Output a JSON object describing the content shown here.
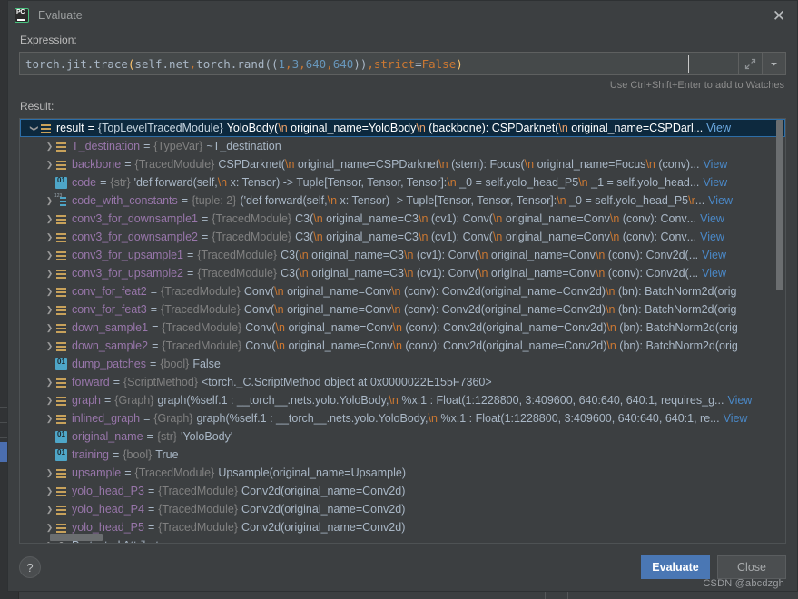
{
  "window": {
    "title": "Evaluate",
    "app_icon": "pycharm-icon",
    "close_icon": "close-icon"
  },
  "expression": {
    "label": "Expression:",
    "tokens": [
      {
        "t": "torch.jit.trace",
        "c": "plain"
      },
      {
        "t": "(",
        "c": "brace-y"
      },
      {
        "t": "self.net",
        "c": "plain"
      },
      {
        "t": ",",
        "c": "punct"
      },
      {
        "t": " torch.rand",
        "c": "plain"
      },
      {
        "t": "((",
        "c": "plain"
      },
      {
        "t": "1",
        "c": "num"
      },
      {
        "t": ",",
        "c": "punct"
      },
      {
        "t": " ",
        "c": "plain"
      },
      {
        "t": "3",
        "c": "num"
      },
      {
        "t": ",",
        "c": "punct"
      },
      {
        "t": " ",
        "c": "plain"
      },
      {
        "t": "640",
        "c": "num"
      },
      {
        "t": ",",
        "c": "punct"
      },
      {
        "t": " ",
        "c": "plain"
      },
      {
        "t": "640",
        "c": "num"
      },
      {
        "t": "))",
        "c": "plain"
      },
      {
        "t": ",",
        "c": "punct"
      },
      {
        "t": " ",
        "c": "plain"
      },
      {
        "t": "strict",
        "c": "kw"
      },
      {
        "t": "=",
        "c": "plain"
      },
      {
        "t": "False",
        "c": "const"
      },
      {
        "t": ")",
        "c": "brace-y"
      }
    ],
    "plain_text": "torch.jit.trace(self.net, torch.rand((1, 3, 640, 640)), strict=False)",
    "expand_icon": "expand-editor-icon",
    "dropdown_icon": "history-dropdown-icon",
    "hint": "Use Ctrl+Shift+Enter to add to Watches"
  },
  "result": {
    "label": "Result:",
    "view_link_label": "View",
    "ellipsis": "...",
    "rows": [
      {
        "indent": 0,
        "arrow": "expanded",
        "icon": "object-icon",
        "selected": true,
        "name": "result",
        "type": "{TopLevelTracedModule}",
        "value": "YoloBody(\\n  original_name=YoloBody\\n  (backbone): CSPDarknet(\\n    original_name=CSPDarl",
        "truncated": true,
        "view": true
      },
      {
        "indent": 1,
        "arrow": "collapsed",
        "icon": "object-icon",
        "selected": false,
        "name": "T_destination",
        "type": "{TypeVar}",
        "value": "~T_destination",
        "truncated": false,
        "view": false
      },
      {
        "indent": 1,
        "arrow": "collapsed",
        "icon": "object-icon",
        "selected": false,
        "name": "backbone",
        "type": "{TracedModule}",
        "value": "CSPDarknet(\\n  original_name=CSPDarknet\\n  (stem): Focus(\\n    original_name=Focus\\n    (conv)",
        "truncated": true,
        "view": true
      },
      {
        "indent": 1,
        "arrow": "none",
        "icon": "primitive-icon",
        "selected": false,
        "name": "code",
        "type": "{str}",
        "value": "'def forward(self,\\n    x: Tensor) -> Tuple[Tensor, Tensor, Tensor]:\\n  _0 = self.yolo_head_P5\\n  _1 = self.yolo_head",
        "truncated": true,
        "view": true
      },
      {
        "indent": 1,
        "arrow": "collapsed",
        "icon": "tuple-icon",
        "selected": false,
        "name": "code_with_constants",
        "type": "{tuple: 2}",
        "value": "('def forward(self,\\n    x: Tensor) -> Tuple[Tensor, Tensor, Tensor]:\\n  _0 = self.yolo_head_P5\\r",
        "truncated": true,
        "view": true
      },
      {
        "indent": 1,
        "arrow": "collapsed",
        "icon": "object-icon",
        "selected": false,
        "name": "conv3_for_downsample1",
        "type": "{TracedModule}",
        "value": "C3(\\n  original_name=C3\\n  (cv1): Conv(\\n    original_name=Conv\\n    (conv): Conv",
        "truncated": true,
        "view": true
      },
      {
        "indent": 1,
        "arrow": "collapsed",
        "icon": "object-icon",
        "selected": false,
        "name": "conv3_for_downsample2",
        "type": "{TracedModule}",
        "value": "C3(\\n  original_name=C3\\n  (cv1): Conv(\\n    original_name=Conv\\n    (conv): Conv",
        "truncated": true,
        "view": true
      },
      {
        "indent": 1,
        "arrow": "collapsed",
        "icon": "object-icon",
        "selected": false,
        "name": "conv3_for_upsample1",
        "type": "{TracedModule}",
        "value": "C3(\\n  original_name=C3\\n  (cv1): Conv(\\n    original_name=Conv\\n    (conv): Conv2d(",
        "truncated": true,
        "view": true
      },
      {
        "indent": 1,
        "arrow": "collapsed",
        "icon": "object-icon",
        "selected": false,
        "name": "conv3_for_upsample2",
        "type": "{TracedModule}",
        "value": "C3(\\n  original_name=C3\\n  (cv1): Conv(\\n    original_name=Conv\\n    (conv): Conv2d(",
        "truncated": true,
        "view": true
      },
      {
        "indent": 1,
        "arrow": "collapsed",
        "icon": "object-icon",
        "selected": false,
        "name": "conv_for_feat2",
        "type": "{TracedModule}",
        "value": "Conv(\\n  original_name=Conv\\n  (conv): Conv2d(original_name=Conv2d)\\n  (bn): BatchNorm2d(orig",
        "truncated": false,
        "view": false
      },
      {
        "indent": 1,
        "arrow": "collapsed",
        "icon": "object-icon",
        "selected": false,
        "name": "conv_for_feat3",
        "type": "{TracedModule}",
        "value": "Conv(\\n  original_name=Conv\\n  (conv): Conv2d(original_name=Conv2d)\\n  (bn): BatchNorm2d(orig",
        "truncated": false,
        "view": false
      },
      {
        "indent": 1,
        "arrow": "collapsed",
        "icon": "object-icon",
        "selected": false,
        "name": "down_sample1",
        "type": "{TracedModule}",
        "value": "Conv(\\n  original_name=Conv\\n  (conv): Conv2d(original_name=Conv2d)\\n  (bn): BatchNorm2d(orig",
        "truncated": false,
        "view": false
      },
      {
        "indent": 1,
        "arrow": "collapsed",
        "icon": "object-icon",
        "selected": false,
        "name": "down_sample2",
        "type": "{TracedModule}",
        "value": "Conv(\\n  original_name=Conv\\n  (conv): Conv2d(original_name=Conv2d)\\n  (bn): BatchNorm2d(orig",
        "truncated": false,
        "view": false
      },
      {
        "indent": 1,
        "arrow": "none",
        "icon": "primitive-icon",
        "selected": false,
        "name": "dump_patches",
        "type": "{bool}",
        "value": "False",
        "truncated": false,
        "view": false
      },
      {
        "indent": 1,
        "arrow": "collapsed",
        "icon": "object-icon",
        "selected": false,
        "name": "forward",
        "type": "{ScriptMethod}",
        "value": "<torch._C.ScriptMethod object at 0x0000022E155F7360>",
        "truncated": false,
        "view": false
      },
      {
        "indent": 1,
        "arrow": "collapsed",
        "icon": "object-icon",
        "selected": false,
        "name": "graph",
        "type": "{Graph}",
        "value": "graph(%self.1 : __torch__.nets.yolo.YoloBody,\\n      %x.1 : Float(1:1228800, 3:409600, 640:640, 640:1, requires_g",
        "truncated": true,
        "view": true
      },
      {
        "indent": 1,
        "arrow": "collapsed",
        "icon": "object-icon",
        "selected": false,
        "name": "inlined_graph",
        "type": "{Graph}",
        "value": "graph(%self.1 : __torch__.nets.yolo.YoloBody,\\n       %x.1 : Float(1:1228800, 3:409600, 640:640, 640:1, re",
        "truncated": true,
        "view": true
      },
      {
        "indent": 1,
        "arrow": "none",
        "icon": "primitive-icon",
        "selected": false,
        "name": "original_name",
        "type": "{str}",
        "value": "'YoloBody'",
        "truncated": false,
        "view": false
      },
      {
        "indent": 1,
        "arrow": "none",
        "icon": "primitive-icon",
        "selected": false,
        "name": "training",
        "type": "{bool}",
        "value": "True",
        "truncated": false,
        "view": false
      },
      {
        "indent": 1,
        "arrow": "collapsed",
        "icon": "object-icon",
        "selected": false,
        "name": "upsample",
        "type": "{TracedModule}",
        "value": "Upsample(original_name=Upsample)",
        "truncated": false,
        "view": false
      },
      {
        "indent": 1,
        "arrow": "collapsed",
        "icon": "object-icon",
        "selected": false,
        "name": "yolo_head_P3",
        "type": "{TracedModule}",
        "value": "Conv2d(original_name=Conv2d)",
        "truncated": false,
        "view": false
      },
      {
        "indent": 1,
        "arrow": "collapsed",
        "icon": "object-icon",
        "selected": false,
        "name": "yolo_head_P4",
        "type": "{TracedModule}",
        "value": "Conv2d(original_name=Conv2d)",
        "truncated": false,
        "view": false
      },
      {
        "indent": 1,
        "arrow": "collapsed",
        "icon": "object-icon",
        "selected": false,
        "name": "yolo_head_P5",
        "type": "{TracedModule}",
        "value": "Conv2d(original_name=Conv2d)",
        "truncated": false,
        "view": false
      },
      {
        "indent": 1,
        "arrow": "collapsed",
        "icon": "key-icon",
        "selected": false,
        "plain": "Protected Attributes"
      }
    ]
  },
  "footer": {
    "help_label": "?",
    "evaluate_label": "Evaluate",
    "close_label": "Close",
    "watermark": "CSDN @abcdzgh"
  },
  "colors": {
    "accent": "#4a77b4",
    "selection": "#0d293e",
    "name": "#9876aa",
    "type": "#808080",
    "escape": "#cc7832",
    "link": "#4a88c7",
    "window_bg": "#3c3f41"
  }
}
